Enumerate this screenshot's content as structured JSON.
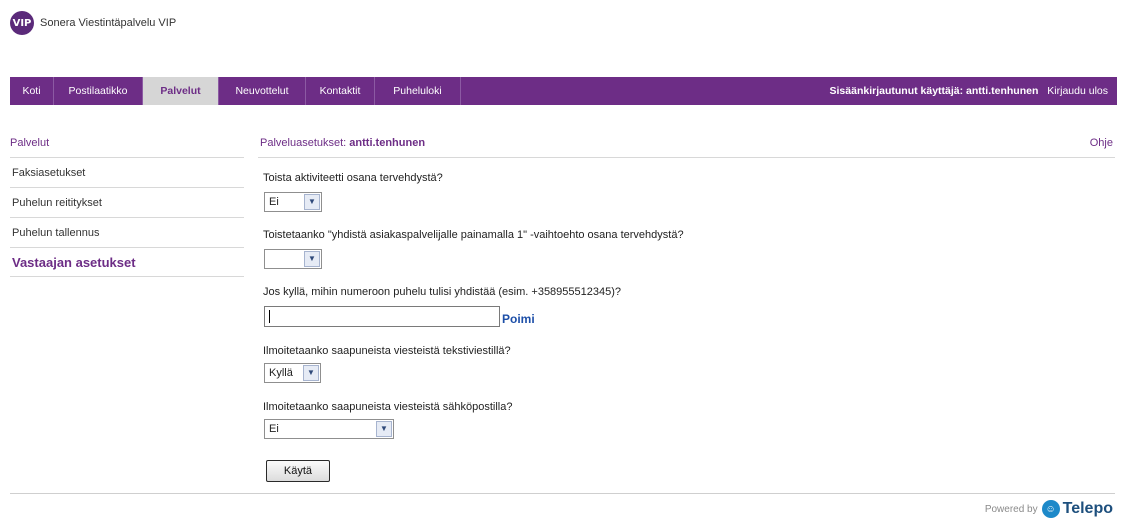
{
  "brand": {
    "badge": "VIP",
    "name": "Sonera Viestintäpalvelu VIP"
  },
  "nav": {
    "items": [
      {
        "label": "Koti"
      },
      {
        "label": "Postilaatikko"
      },
      {
        "label": "Palvelut"
      },
      {
        "label": "Neuvottelut"
      },
      {
        "label": "Kontaktit"
      },
      {
        "label": "Puheluloki"
      }
    ],
    "user_prefix": "Sisäänkirjautunut käyttäjä:",
    "username": "antti.tenhunen",
    "logout": "Kirjaudu ulos"
  },
  "sidebar": {
    "title": "Palvelut",
    "items": [
      {
        "label": "Faksiasetukset"
      },
      {
        "label": "Puhelun reititykset"
      },
      {
        "label": "Puhelun tallennus"
      },
      {
        "label": "Vastaajan asetukset"
      }
    ]
  },
  "main": {
    "title_prefix": "Palveluasetukset:",
    "title_user": "antti.tenhunen",
    "help": "Ohje",
    "q1": {
      "label": "Toista aktiviteetti osana tervehdystä?",
      "value": "Ei"
    },
    "q2": {
      "label": "Toistetaanko \"yhdistä asiakaspalvelijalle painamalla 1\" -vaihtoehto osana tervehdystä?",
      "value": ""
    },
    "q3": {
      "label": "Jos kyllä, mihin numeroon puhelu tulisi yhdistää (esim. +358955512345)?",
      "value": "",
      "pick": "Poimi"
    },
    "q4": {
      "label": "Ilmoitetaanko saapuneista viesteistä tekstiviestillä?",
      "value": "Kyllä"
    },
    "q5": {
      "label": "Ilmoitetaanko saapuneista viesteistä sähköpostilla?",
      "value": "Ei"
    },
    "apply": "Käytä"
  },
  "footer": {
    "powered_by": "Powered by",
    "vendor": "Telepo"
  }
}
